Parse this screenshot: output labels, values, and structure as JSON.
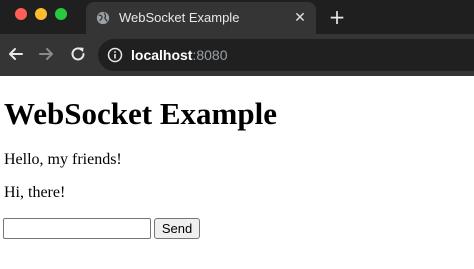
{
  "window": {
    "controls": [
      "close",
      "minimize",
      "zoom"
    ]
  },
  "tab": {
    "title": "WebSocket Example",
    "icon": "globe-icon",
    "close_icon": "close-icon"
  },
  "new_tab_icon": "plus-icon",
  "toolbar": {
    "back_icon": "back-arrow-icon",
    "forward_icon": "forward-arrow-icon",
    "reload_icon": "reload-icon",
    "info_icon": "info-icon",
    "url_host": "localhost",
    "url_port": ":8080"
  },
  "page": {
    "heading": "WebSocket Example",
    "messages": [
      "Hello, my friends!",
      "Hi, there!"
    ],
    "input_value": "",
    "send_label": "Send"
  },
  "colors": {
    "tabstrip": "#1f1f1f",
    "toolbar": "#353535",
    "omnibox": "#202020",
    "traffic_red": "#ff5f57",
    "traffic_yellow": "#febc2e",
    "traffic_green": "#28c840"
  }
}
